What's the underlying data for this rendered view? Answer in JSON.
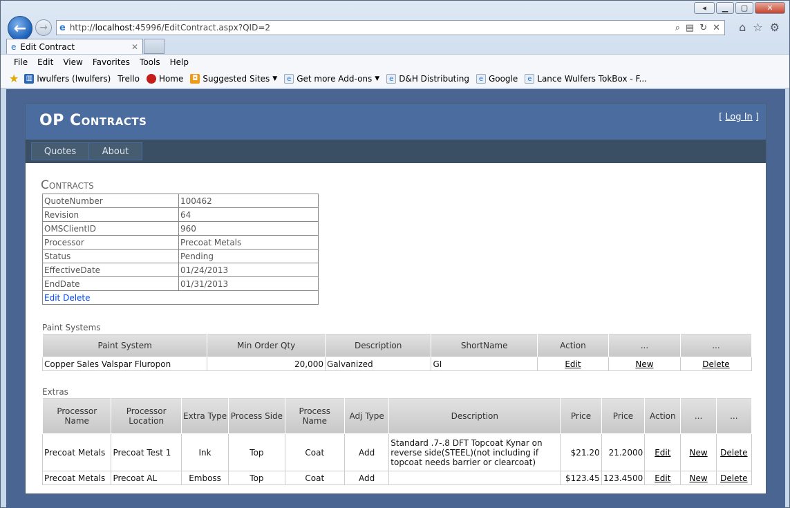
{
  "browser": {
    "url_prefix": "http://",
    "url_host": "localhost",
    "url_rest": ":45996/EditContract.aspx?QID=2",
    "tab_title": "Edit Contract",
    "menu": [
      "File",
      "Edit",
      "View",
      "Favorites",
      "Tools",
      "Help"
    ],
    "favorites": [
      {
        "label": "lwulfers (lwulfers)",
        "icon": "trello-icon"
      },
      {
        "label": "Trello",
        "icon": ""
      },
      {
        "label": "Home",
        "icon": "home-favicon"
      },
      {
        "label": "Suggested Sites",
        "icon": "suggested-sites-icon",
        "dropdown": true
      },
      {
        "label": "Get more Add-ons",
        "icon": "ie-page-icon",
        "dropdown": true
      },
      {
        "label": "D&H Distributing",
        "icon": "ie-page-icon"
      },
      {
        "label": "Google",
        "icon": "ie-page-icon"
      },
      {
        "label": "Lance Wulfers  TokBox - F...",
        "icon": "ie-page-icon"
      }
    ]
  },
  "site": {
    "title": "OP Contracts",
    "login_open": "[ ",
    "login_link": "Log In",
    "login_close": " ]",
    "nav": [
      "Quotes",
      "About"
    ]
  },
  "contracts": {
    "heading": "Contracts",
    "fields": [
      {
        "key": "QuoteNumber",
        "value": "100462"
      },
      {
        "key": "Revision",
        "value": "64"
      },
      {
        "key": "OMSClientID",
        "value": "960"
      },
      {
        "key": "Processor",
        "value": "Precoat Metals"
      },
      {
        "key": "Status",
        "value": "Pending"
      },
      {
        "key": "EffectiveDate",
        "value": "01/24/2013"
      },
      {
        "key": "EndDate",
        "value": "01/31/2013"
      }
    ],
    "edit_link": "Edit",
    "delete_link": "Delete"
  },
  "paint_systems": {
    "label": "Paint Systems",
    "headers": [
      "Paint System",
      "Min Order Qty",
      "Description",
      "ShortName",
      "Action",
      "...",
      "..."
    ],
    "rows": [
      {
        "paint_system": "Copper Sales Valspar Fluropon",
        "min_order_qty": "20,000",
        "description": "Galvanized",
        "short_name": "GI",
        "edit": "Edit",
        "new": "New",
        "delete": "Delete"
      }
    ]
  },
  "extras": {
    "label": "Extras",
    "headers": [
      "Processor Name",
      "Processor Location",
      "Extra Type",
      "Process Side",
      "Process Name",
      "Adj Type",
      "Description",
      "Price",
      "Price",
      "Action",
      "...",
      "..."
    ],
    "rows": [
      {
        "processor_name": "Precoat Metals",
        "processor_location": "Precoat Test 1",
        "extra_type": "Ink",
        "process_side": "Top",
        "process_name": "Coat",
        "adj_type": "Add",
        "description": "Standard .7-.8 DFT Topcoat Kynar on reverse side(STEEL)(not including if topcoat needs barrier or clearcoat)",
        "price": "$21.20",
        "price2": "21.2000",
        "edit": "Edit",
        "new": "New",
        "delete": "Delete"
      },
      {
        "processor_name": "Precoat Metals",
        "processor_location": "Precoat AL",
        "extra_type": "Emboss",
        "process_side": "Top",
        "process_name": "Coat",
        "adj_type": "Add",
        "description": "",
        "price": "$123.45",
        "price2": "123.4500",
        "edit": "Edit",
        "new": "New",
        "delete": "Delete"
      }
    ]
  }
}
